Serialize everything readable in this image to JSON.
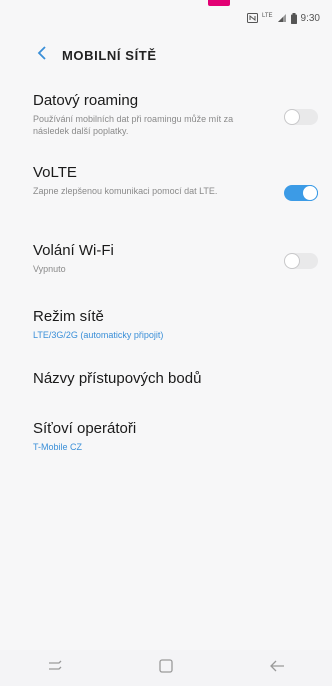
{
  "status_bar": {
    "nfc_icon": "nfc-icon",
    "network_type": "LTE",
    "signal_icon": "signal-icon",
    "battery_icon": "battery-icon",
    "time": "9:30"
  },
  "header": {
    "back_icon": "chevron-left-icon",
    "title": "MOBILNÍ SÍTĚ"
  },
  "settings": [
    {
      "label": "Datový roaming",
      "sub": "Používání mobilních dat při roamingu může mít za následek další poplatky.",
      "toggle": "off"
    },
    {
      "label": "VoLTE",
      "sub": "Zapne zlepšenou komunikaci pomocí dat LTE.",
      "toggle": "on"
    },
    {
      "label": "Volání Wi-Fi",
      "sub": "Vypnuto",
      "toggle": "off"
    },
    {
      "label": "Režim sítě",
      "sub": "LTE/3G/2G (automaticky připojit)"
    },
    {
      "label": "Názvy přístupových bodů"
    },
    {
      "label": "Síťoví operátoři",
      "sub": "T-Mobile CZ"
    }
  ],
  "nav_bar": {
    "recents_icon": "recents-icon",
    "home_icon": "home-icon",
    "back_icon": "back-arrow-icon"
  },
  "colors": {
    "accent": "#3c9be6",
    "link_text": "#3a8fd8",
    "brand": "#e20074"
  }
}
